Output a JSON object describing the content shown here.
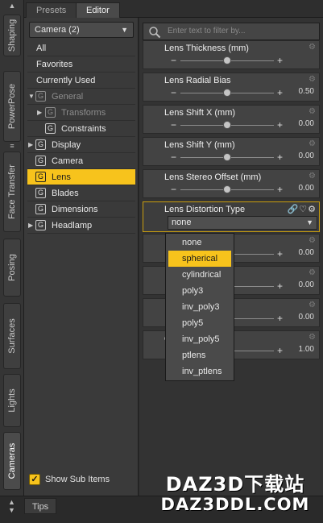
{
  "side_tabs": [
    "Shaping",
    "PowerPose",
    "Face Transfer",
    "Posing",
    "Surfaces",
    "Lights",
    "Cameras"
  ],
  "top_tabs": [
    "Presets",
    "Editor"
  ],
  "camera_select": "Camera (2)",
  "nav": [
    {
      "label": "All"
    },
    {
      "label": "Favorites"
    },
    {
      "label": "Currently Used"
    },
    {
      "label": "General"
    },
    {
      "label": "Transforms"
    },
    {
      "label": "Constraints"
    },
    {
      "label": "Display"
    },
    {
      "label": "Camera"
    },
    {
      "label": "Lens"
    },
    {
      "label": "Blades"
    },
    {
      "label": "Dimensions"
    },
    {
      "label": "Headlamp"
    }
  ],
  "show_sub_items": "Show Sub Items",
  "filter_placeholder": "Enter text to filter by...",
  "properties": [
    {
      "name": "Lens Thickness (mm)",
      "value": "",
      "level": 0.5
    },
    {
      "name": "Lens Radial Bias",
      "value": "0.50",
      "level": 0.5
    },
    {
      "name": "Lens Shift X (mm)",
      "value": "0.00",
      "level": 0.5
    },
    {
      "name": "Lens Shift Y (mm)",
      "value": "0.00",
      "level": 0.5
    },
    {
      "name": "Lens Stereo Offset (mm)",
      "value": "0.00",
      "level": 0.5
    },
    {
      "name": "",
      "value": "0.00",
      "level": 0.5
    },
    {
      "name": "",
      "value": "0.00",
      "level": 0.5
    },
    {
      "name": "",
      "value": "0.00",
      "level": 0.5
    },
    {
      "name": "cale",
      "value": "1.00",
      "level": 0.5
    }
  ],
  "lens_distortion": {
    "name": "Lens Distortion Type",
    "value": "none",
    "options": [
      "none",
      "spherical",
      "cylindrical",
      "poly3",
      "inv_poly3",
      "poly5",
      "inv_poly5",
      "ptlens",
      "inv_ptlens"
    ],
    "highlighted": "spherical"
  },
  "tips_tab": "Tips",
  "watermark": {
    "line1": "DAZ3D下载站",
    "line2": "DAZ3DDL.COM"
  },
  "colors": {
    "accent": "#f7c31c"
  }
}
